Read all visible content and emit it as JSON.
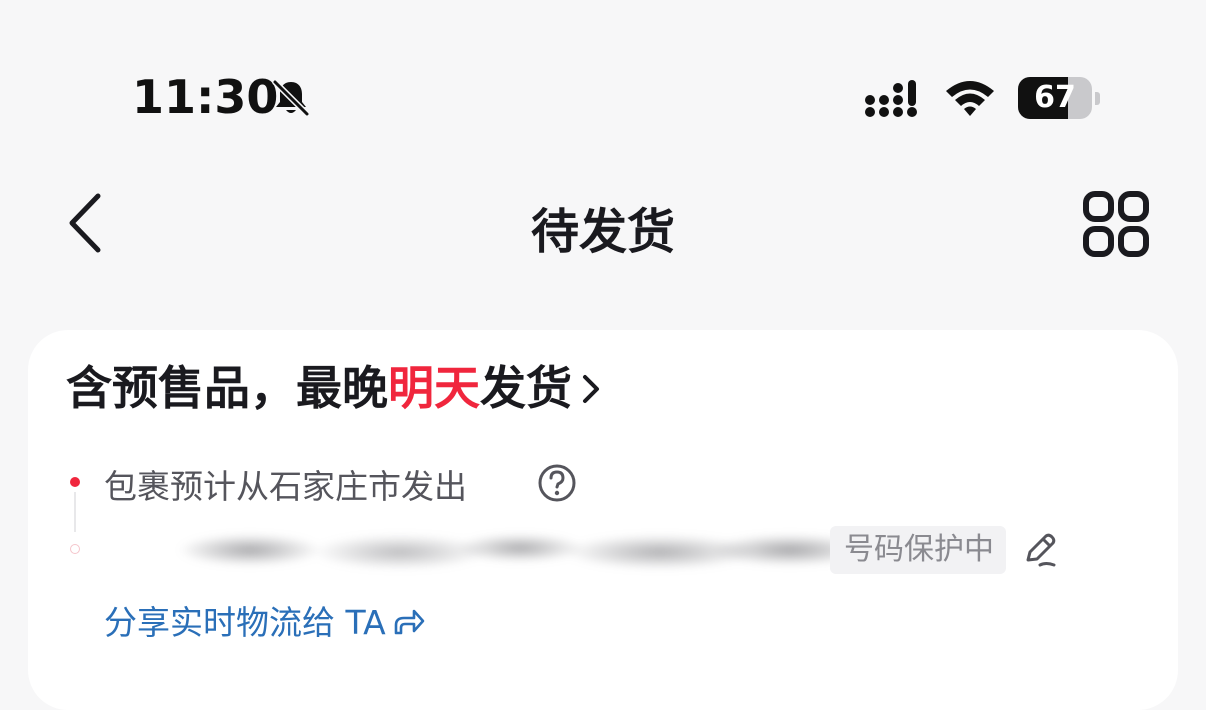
{
  "status_bar": {
    "time": "11:30",
    "battery_percent": "67",
    "battery_level": 0.67,
    "icons": [
      "bell-slash-icon",
      "cellular-signal-icon",
      "wifi-icon",
      "battery-icon"
    ]
  },
  "nav": {
    "title": "待发货",
    "back_icon": "chevron-left-icon",
    "menu_icon": "grid-four-icon"
  },
  "shipping": {
    "headline_prefix": "含预售品，最晚",
    "headline_highlight": "明天",
    "headline_suffix": "发货",
    "origin": "包裹预计从石家庄市发出",
    "privacy_badge": "号码保护中",
    "share_link": "分享实时物流给 TA"
  },
  "colors": {
    "accent_red": "#f0263d",
    "link_blue": "#2a6fb8",
    "text_primary": "#1a1a1f",
    "text_secondary": "#55555c",
    "background": "#f7f7f8",
    "card": "#ffffff"
  }
}
